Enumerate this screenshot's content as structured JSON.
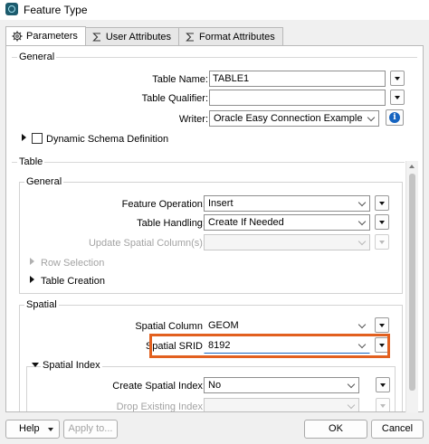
{
  "window": {
    "title": "Feature Type"
  },
  "tabs": [
    {
      "label": "Parameters",
      "icon": "gear-icon",
      "active": true
    },
    {
      "label": "User Attributes",
      "icon": "sigma-icon",
      "active": false
    },
    {
      "label": "Format Attributes",
      "icon": "sigma-icon",
      "active": false
    }
  ],
  "general": {
    "title": "General",
    "table_name": {
      "label": "Table Name:",
      "value": "TABLE1"
    },
    "table_qualifier": {
      "label": "Table Qualifier:",
      "value": ""
    },
    "writer": {
      "label": "Writer:",
      "value": "Oracle Easy Connection Example [ORACI"
    },
    "dynamic_schema": {
      "label": "Dynamic Schema Definition",
      "checked": false
    }
  },
  "table": {
    "title": "Table",
    "general": {
      "title": "General",
      "feature_operation": {
        "label": "Feature Operation:",
        "value": "Insert"
      },
      "table_handling": {
        "label": "Table Handling:",
        "value": "Create If Needed"
      },
      "update_spatial_columns": {
        "label": "Update Spatial Column(s):",
        "value": ""
      },
      "row_selection": "Row Selection",
      "table_creation": "Table Creation"
    },
    "spatial": {
      "title": "Spatial",
      "spatial_column": {
        "label": "Spatial Column:",
        "value": "GEOM"
      },
      "spatial_srid": {
        "label": "Spatial SRID:",
        "value": "8192"
      },
      "spatial_index": {
        "title": "Spatial Index",
        "create_spatial_index": {
          "label": "Create Spatial Index:",
          "value": "No"
        },
        "drop_existing_index": {
          "label": "Drop Existing Index:"
        }
      }
    }
  },
  "footer": {
    "help_label": "Help",
    "apply_label": "Apply to...",
    "ok_label": "OK",
    "cancel_label": "Cancel"
  },
  "colors": {
    "highlight": "#e2601f",
    "info_icon": "#1664c0"
  }
}
